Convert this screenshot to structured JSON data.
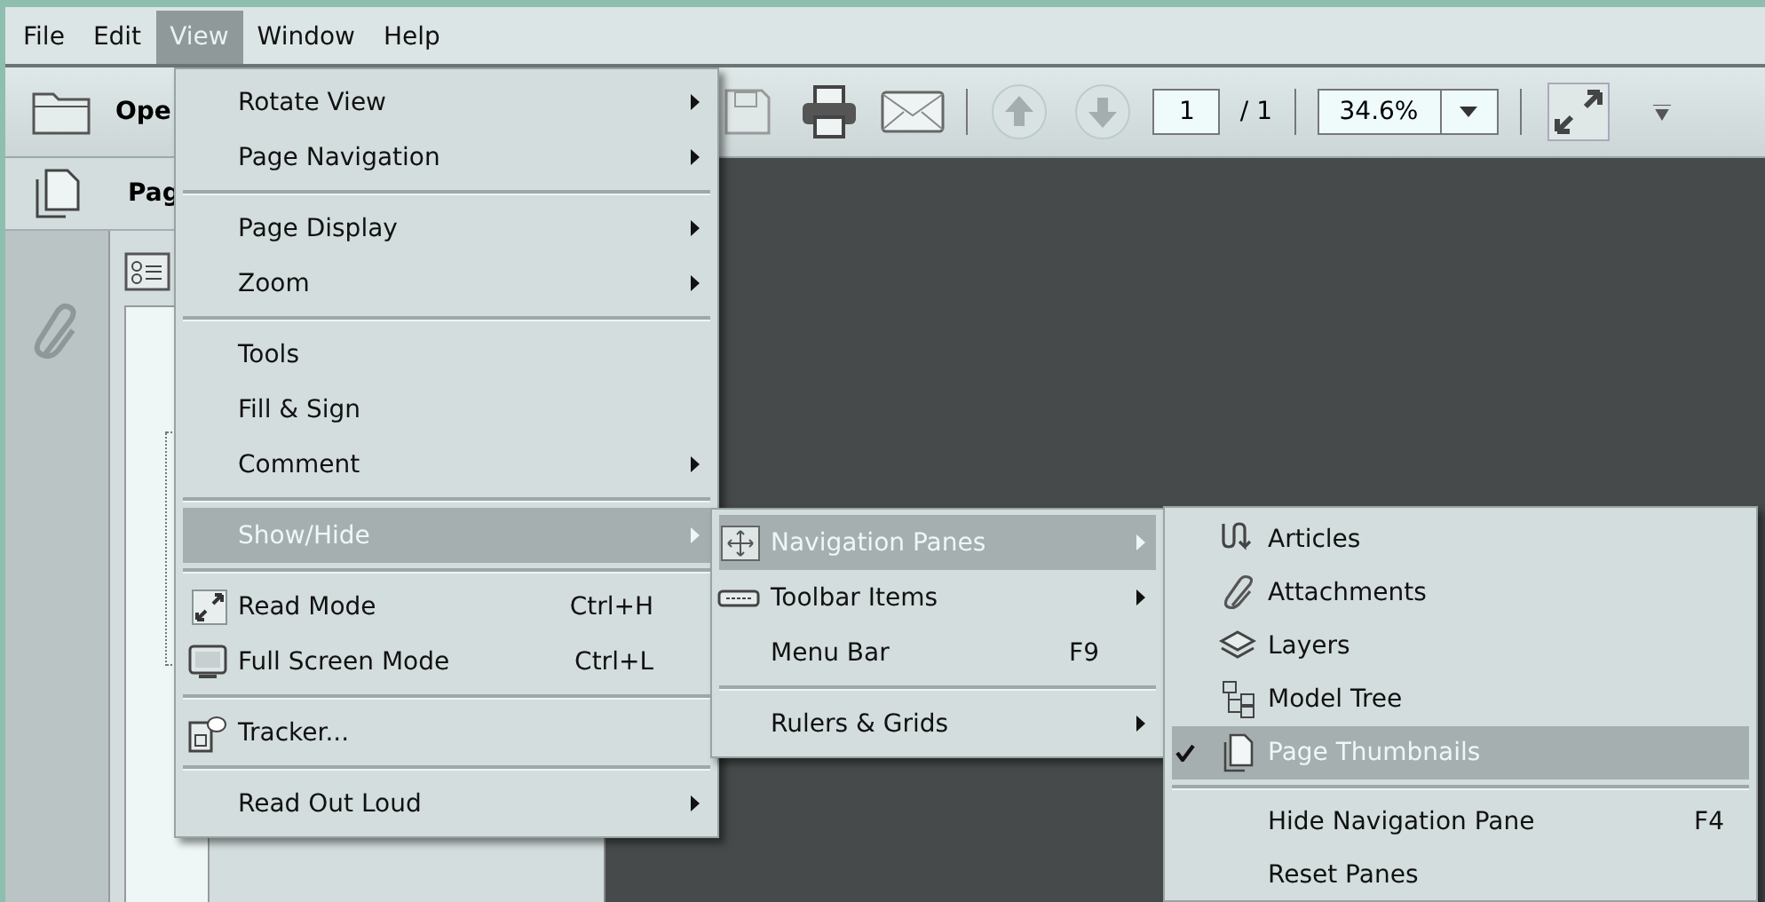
{
  "menu_bar": [
    {
      "label": "File",
      "selected": false
    },
    {
      "label": "Edit",
      "selected": false
    },
    {
      "label": "View",
      "selected": true
    },
    {
      "label": "Window",
      "selected": false
    },
    {
      "label": "Help",
      "selected": false
    }
  ],
  "toolbar": {
    "open_label": "Ope",
    "page_number": "1",
    "page_total": "/ 1",
    "zoom": "34.6%"
  },
  "nav_pane": {
    "header": "Pag"
  },
  "view_menu": {
    "groups": [
      {
        "items": [
          {
            "label": "Rotate View",
            "submenu": true,
            "selected": false
          },
          {
            "label": "Page Navigation",
            "submenu": true,
            "selected": false
          }
        ]
      },
      {
        "items": [
          {
            "label": "Page Display",
            "submenu": true,
            "selected": false
          },
          {
            "label": "Zoom",
            "submenu": true,
            "selected": false
          }
        ]
      },
      {
        "items": [
          {
            "label": "Tools",
            "submenu": false,
            "selected": false
          },
          {
            "label": "Fill & Sign",
            "submenu": false,
            "selected": false
          },
          {
            "label": "Comment",
            "submenu": true,
            "selected": false
          }
        ]
      },
      {
        "items": [
          {
            "label": "Show/Hide",
            "submenu": true,
            "selected": true
          }
        ]
      },
      {
        "items": [
          {
            "label": "Read Mode",
            "shortcut": "Ctrl+H",
            "submenu": false,
            "selected": false
          },
          {
            "label": "Full Screen Mode",
            "shortcut": "Ctrl+L",
            "submenu": false,
            "selected": false
          }
        ]
      },
      {
        "items": [
          {
            "label": "Tracker...",
            "submenu": false,
            "selected": false
          }
        ]
      },
      {
        "items": [
          {
            "label": "Read Out Loud",
            "submenu": true,
            "selected": false
          }
        ]
      }
    ]
  },
  "show_hide_menu": {
    "groups": [
      {
        "items": [
          {
            "label": "Navigation Panes",
            "submenu": true,
            "selected": true
          },
          {
            "label": "Toolbar Items",
            "submenu": true,
            "selected": false
          },
          {
            "label": "Menu Bar",
            "shortcut": "F9",
            "submenu": false,
            "selected": false
          }
        ]
      },
      {
        "items": [
          {
            "label": "Rulers & Grids",
            "submenu": true,
            "selected": false
          }
        ]
      }
    ]
  },
  "navigation_panes_menu": {
    "groups": [
      {
        "items": [
          {
            "label": "Articles",
            "checked": false,
            "selected": false
          },
          {
            "label": "Attachments",
            "checked": false,
            "selected": false
          },
          {
            "label": "Layers",
            "checked": false,
            "selected": false
          },
          {
            "label": "Model Tree",
            "checked": false,
            "selected": false
          },
          {
            "label": "Page Thumbnails",
            "checked": true,
            "selected": true
          }
        ]
      },
      {
        "items": [
          {
            "label": "Hide Navigation Pane",
            "shortcut": "F4",
            "checked": false,
            "selected": false
          },
          {
            "label": "Reset Panes",
            "checked": false,
            "selected": false
          }
        ]
      }
    ]
  }
}
